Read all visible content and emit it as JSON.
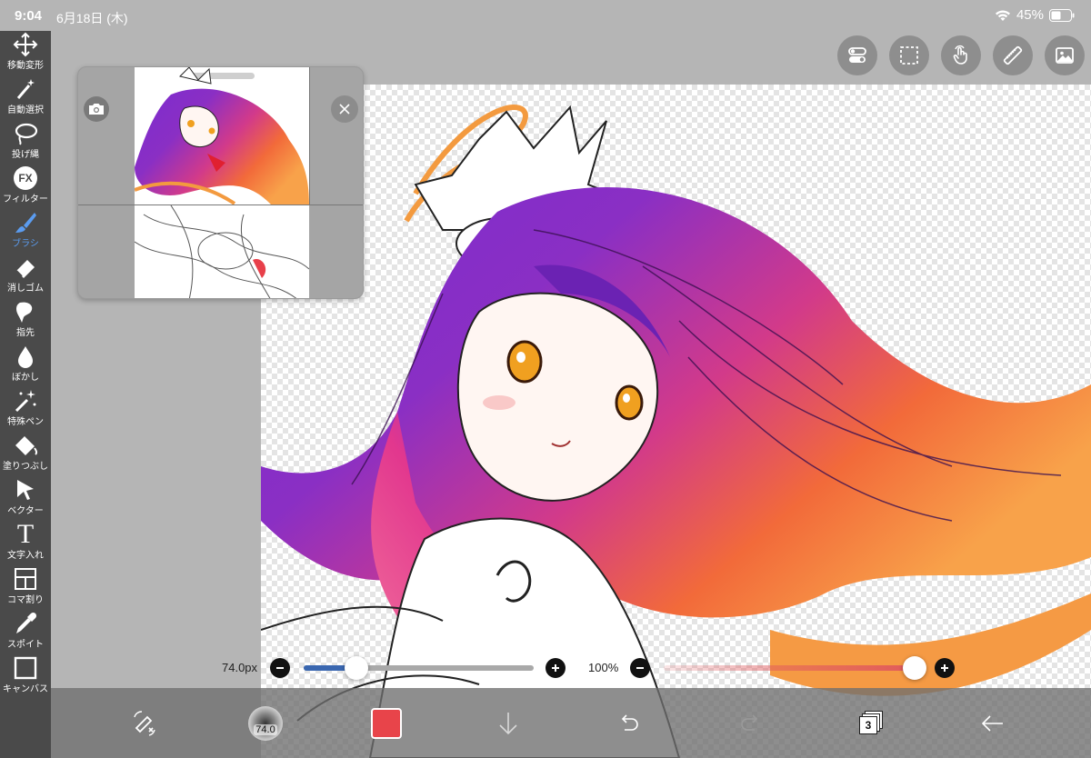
{
  "status": {
    "time": "9:04",
    "date": "6月18日 (木)",
    "battery": "45%"
  },
  "toolbar": {
    "items": [
      {
        "id": "move",
        "label": "移動変形",
        "icon": "move-arrows-icon"
      },
      {
        "id": "auto-select",
        "label": "自動選択",
        "icon": "magic-wand-icon"
      },
      {
        "id": "lasso",
        "label": "投げ縄",
        "icon": "lasso-icon"
      },
      {
        "id": "filter",
        "label": "フィルター",
        "icon": "fx-icon",
        "glyph": "FX"
      },
      {
        "id": "brush",
        "label": "ブラシ",
        "icon": "brush-icon",
        "active": true
      },
      {
        "id": "eraser",
        "label": "消しゴム",
        "icon": "eraser-icon"
      },
      {
        "id": "finger",
        "label": "指先",
        "icon": "smudge-icon"
      },
      {
        "id": "blur",
        "label": "ぼかし",
        "icon": "drop-icon"
      },
      {
        "id": "special-pen",
        "label": "特殊ペン",
        "icon": "sparkle-pen-icon"
      },
      {
        "id": "fill",
        "label": "塗りつぶし",
        "icon": "bucket-icon"
      },
      {
        "id": "vector",
        "label": "ベクター",
        "icon": "cursor-arrow-icon"
      },
      {
        "id": "text",
        "label": "文字入れ",
        "icon": "text-icon",
        "glyph": "T"
      },
      {
        "id": "frame",
        "label": "コマ割り",
        "icon": "frame-divide-icon"
      },
      {
        "id": "eyedropper",
        "label": "スポイト",
        "icon": "eyedropper-icon"
      },
      {
        "id": "canvas",
        "label": "キャンバス",
        "icon": "canvas-icon"
      }
    ]
  },
  "top_buttons": [
    "toggle-icon",
    "selection-marquee-icon",
    "touch-hand-icon",
    "ruler-icon",
    "image-icon"
  ],
  "brush_size": {
    "label": "74.0px",
    "value_fraction": 0.23
  },
  "opacity": {
    "label": "100%",
    "value_fraction": 1.0
  },
  "bottombar": {
    "brush_size_badge": "74.0",
    "layer_count": "3",
    "current_color": "#e8444a"
  },
  "colors": {
    "accent": "#5b9cf0",
    "slider_blue": "#3a67b0",
    "opacity_red": "#e0595d"
  }
}
